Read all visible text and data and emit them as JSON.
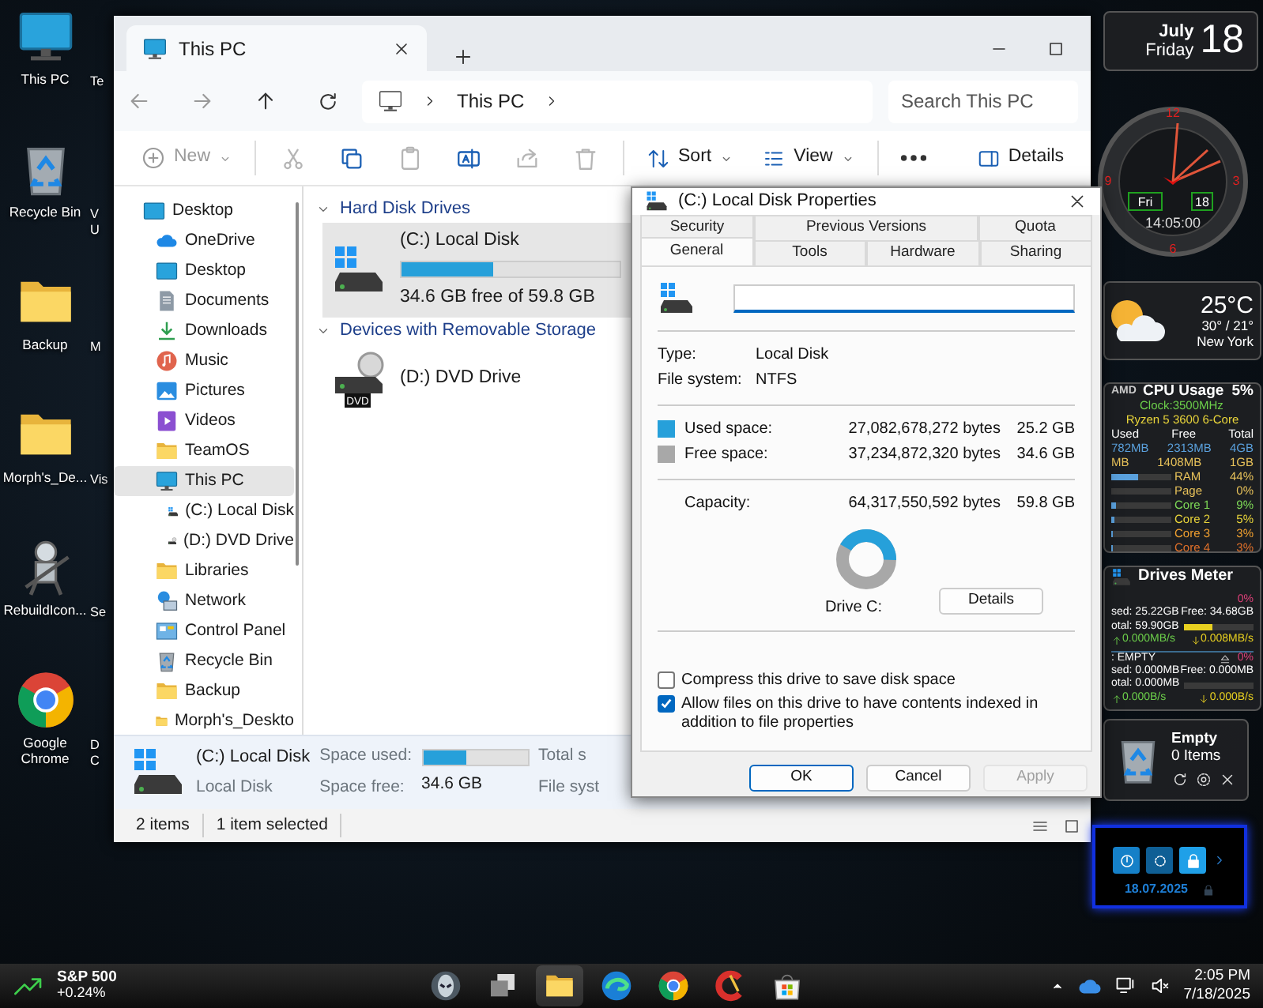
{
  "desktop_icons": [
    {
      "label": "This PC",
      "kind": "monitor"
    },
    {
      "label": "Recycle Bin",
      "kind": "recycle"
    },
    {
      "label": "Backup",
      "kind": "folder"
    },
    {
      "label": "Morph's_De...",
      "kind": "folder"
    },
    {
      "label": "RebuildIcon...",
      "kind": "robot"
    },
    {
      "label": "Google Chrome",
      "kind": "chrome"
    }
  ],
  "desktop_icons_partial": [
    [
      "Te"
    ],
    [
      "V",
      "U"
    ],
    [
      "M"
    ],
    [
      "Vis"
    ],
    [
      "Se"
    ],
    [
      "D",
      "C"
    ]
  ],
  "explorer": {
    "tab": {
      "title": "This PC"
    },
    "address": [
      "This PC"
    ],
    "search": {
      "placeholder": "Search This PC"
    },
    "toolbar": {
      "new": {
        "label": "New",
        "disabled": true
      },
      "actions": [
        {
          "kind": "cut",
          "disabled": true
        },
        {
          "kind": "copy",
          "disabled": false
        },
        {
          "kind": "paste",
          "disabled": true
        },
        {
          "kind": "rename",
          "disabled": false
        },
        {
          "kind": "share",
          "disabled": true
        },
        {
          "kind": "delete",
          "disabled": true
        }
      ],
      "sort": "Sort",
      "view": "View",
      "details": "Details"
    },
    "sidebar": [
      {
        "label": "Desktop",
        "kind": "desktop",
        "selected": false,
        "children": [
          {
            "label": "OneDrive",
            "kind": "cloud",
            "selected": false
          },
          {
            "label": "Desktop",
            "kind": "desktop",
            "selected": false
          },
          {
            "label": "Documents",
            "kind": "documents",
            "selected": false
          },
          {
            "label": "Downloads",
            "kind": "download",
            "selected": false
          },
          {
            "label": "Music",
            "kind": "music",
            "selected": false
          },
          {
            "label": "Pictures",
            "kind": "pictures",
            "selected": false
          },
          {
            "label": "Videos",
            "kind": "videos",
            "selected": false
          },
          {
            "label": "TeamOS",
            "kind": "folder",
            "selected": false
          },
          {
            "label": "This PC",
            "kind": "monitor",
            "selected": true,
            "children": [
              {
                "label": "(C:) Local Disk",
                "kind": "drive",
                "selected": false
              },
              {
                "label": "(D:) DVD Drive",
                "kind": "dvd",
                "selected": false
              }
            ]
          },
          {
            "label": "Libraries",
            "kind": "folder",
            "selected": false
          },
          {
            "label": "Network",
            "kind": "network",
            "selected": false
          },
          {
            "label": "Control Panel",
            "kind": "control",
            "selected": false
          },
          {
            "label": "Recycle Bin",
            "kind": "recycle",
            "selected": false
          },
          {
            "label": "Backup",
            "kind": "folder",
            "selected": false
          },
          {
            "label": "Morph's_Deskto",
            "kind": "folder",
            "selected": false
          }
        ]
      }
    ],
    "groups": [
      {
        "title": "Hard Disk Drives",
        "expanded": true,
        "items": [
          {
            "name": "(C:) Local Disk",
            "kind": "drive",
            "selected": true,
            "level": 0.42,
            "caption": "34.6 GB free of 59.8 GB"
          }
        ]
      },
      {
        "title": "Devices with Removable Storage",
        "expanded": true,
        "items": [
          {
            "name": "(D:) DVD Drive",
            "kind": "dvd",
            "selected": false,
            "icon_label": "DVD"
          }
        ]
      }
    ],
    "details_pane": {
      "name": "(C:) Local Disk",
      "type": "Local Disk",
      "used_label": "Space used:",
      "level": 0.42,
      "free_label": "Space free:",
      "free": "34.6 GB",
      "total_label": "Total s",
      "fs_label": "File syst"
    },
    "status": [
      "2 items",
      "1 item selected"
    ]
  },
  "dialog": {
    "title": "(C:) Local Disk Properties",
    "tab_rows": [
      [
        {
          "label": "Security",
          "selected": false
        },
        {
          "label": "Previous Versions",
          "selected": false
        },
        {
          "label": "Quota",
          "selected": false
        }
      ],
      [
        {
          "label": "General",
          "selected": true
        },
        {
          "label": "Tools",
          "selected": false
        },
        {
          "label": "Hardware",
          "selected": false
        },
        {
          "label": "Sharing",
          "selected": false
        }
      ]
    ],
    "info": [
      {
        "label": "Type:",
        "value": "Local Disk"
      },
      {
        "label": "File system:",
        "value": "NTFS"
      }
    ],
    "space": [
      {
        "label": "Used space:",
        "color": "#26a0da",
        "bytes": "27,082,678,272 bytes",
        "size": "25.2 GB"
      },
      {
        "label": "Free space:",
        "color": "#a8a8a8",
        "bytes": "37,234,872,320 bytes",
        "size": "34.6 GB"
      }
    ],
    "capacity": {
      "label": "Capacity:",
      "bytes": "64,317,550,592 bytes",
      "size": "59.8 GB"
    },
    "usage_ring": {
      "level": 0.42
    },
    "drive_label": "Drive C:",
    "details_button": "Details",
    "options": [
      {
        "label": "Compress this drive to save disk space",
        "checked": false
      },
      {
        "label": "Allow files on this drive to have contents indexed in addition to file properties",
        "checked": true
      }
    ],
    "buttons": [
      {
        "label": "OK",
        "kind": "default",
        "disabled": false
      },
      {
        "label": "Cancel",
        "kind": "normal",
        "disabled": false
      },
      {
        "label": "Apply",
        "kind": "normal",
        "disabled": true
      }
    ]
  },
  "widgets": {
    "date": {
      "month": "July",
      "weekday": "Friday",
      "day": "18"
    },
    "clock": {
      "numerals": [
        "12",
        "3",
        "6",
        "9"
      ],
      "weekday": "Fri",
      "day": "18",
      "time": "14:05:00"
    },
    "weather": {
      "temp": "25°C",
      "range": "30° / 21°",
      "city": "New York"
    },
    "cpu": {
      "brand": "AMD",
      "title": "CPU Usage",
      "percent": "5%",
      "clock": "Clock:3500MHz",
      "model": "Ryzen 5 3600 6-Core",
      "columns": [
        "Used",
        "Free",
        "Total"
      ],
      "rows": [
        [
          "782MB",
          "2313MB",
          "4GB"
        ],
        [
          "MB",
          "1408MB",
          "1GB"
        ]
      ],
      "meters": [
        {
          "label": "RAM",
          "value": "44%",
          "level": 0.44,
          "color": "#e8c25a"
        },
        {
          "label": "Page",
          "value": "0%",
          "level": 0,
          "color": "#e8c25a"
        },
        {
          "label": "Core 1",
          "value": "9%",
          "level": 0.09,
          "color": "#7ed957"
        },
        {
          "label": "Core 2",
          "value": "5%",
          "level": 0.05,
          "color": "#e8d43a"
        },
        {
          "label": "Core 3",
          "value": "3%",
          "level": 0.03,
          "color": "#f0a030"
        },
        {
          "label": "Core 4",
          "value": "3%",
          "level": 0.03,
          "color": "#e0702a"
        }
      ]
    },
    "drives": {
      "title": "Drives Meter",
      "drives": [
        {
          "percent": "0%",
          "used": "sed: 25.22GB",
          "free": "Free: 34.68GB",
          "total": "otal: 59.90GB",
          "level": 0.42,
          "read": "0.000MB/s",
          "write": "0.008MB/s",
          "ejectable": false
        },
        {
          "label": ": EMPTY",
          "percent": "0%",
          "used": "sed: 0.000MB",
          "free": "Free: 0.000MB",
          "total": "otal: 0.000MB",
          "level": 0,
          "read": "0.000B/s",
          "write": "0.000B/s",
          "ejectable": true
        }
      ]
    },
    "recycle": {
      "title": "Empty",
      "count": "0 Items"
    },
    "lock": {
      "date": "18.07.2025"
    }
  },
  "taskbar": {
    "ticker": {
      "name": "S&P 500",
      "change": "+0.24%"
    },
    "apps": [
      {
        "kind": "alien",
        "active": false
      },
      {
        "kind": "taskview",
        "active": false
      },
      {
        "kind": "folder",
        "active": true
      },
      {
        "kind": "edge",
        "active": false
      },
      {
        "kind": "chrome",
        "active": false
      },
      {
        "kind": "ccleaner",
        "active": false
      },
      {
        "kind": "store",
        "active": false
      }
    ],
    "clock": {
      "time": "2:05 PM",
      "date": "7/18/2025"
    }
  }
}
